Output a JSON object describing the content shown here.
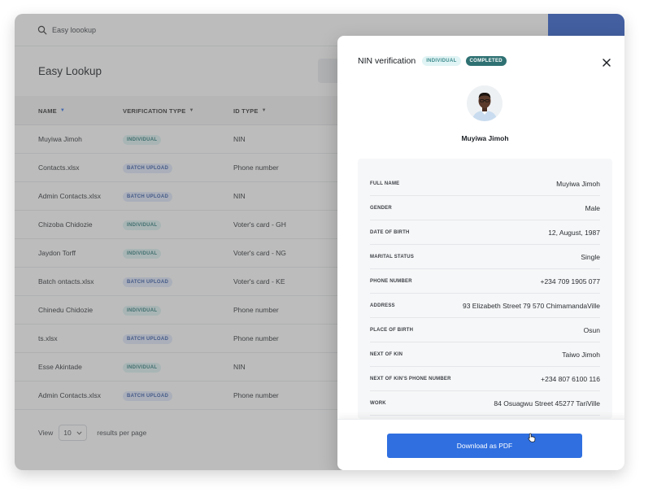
{
  "search": {
    "text": "Easy loookup"
  },
  "page": {
    "title": "Easy Lookup"
  },
  "table": {
    "headers": {
      "name": "NAME",
      "verification_type": "VERIFICATION TYPE",
      "id_type": "ID TYPE"
    },
    "rows": [
      {
        "name": "Muyiwa Jimoh",
        "type": "INDIVIDUAL",
        "id_type": "NIN"
      },
      {
        "name": "Contacts.xlsx",
        "type": "BATCH UPLOAD",
        "id_type": "Phone number"
      },
      {
        "name": "Admin Contacts.xlsx",
        "type": "BATCH UPLOAD",
        "id_type": "NIN"
      },
      {
        "name": "Chizoba Chidozie",
        "type": "INDIVIDUAL",
        "id_type": "Voter's card - GH"
      },
      {
        "name": "Jaydon Torff",
        "type": "INDIVIDUAL",
        "id_type": "Voter's card - NG"
      },
      {
        "name": "Batch ontacts.xlsx",
        "type": "BATCH UPLOAD",
        "id_type": "Voter's card - KE"
      },
      {
        "name": "Chinedu Chidozie",
        "type": "INDIVIDUAL",
        "id_type": "Phone number"
      },
      {
        "name": "ts.xlsx",
        "type": "BATCH UPLOAD",
        "id_type": "Phone number"
      },
      {
        "name": "Esse Akintade",
        "type": "INDIVIDUAL",
        "id_type": "NIN"
      },
      {
        "name": "Admin Contacts.xlsx",
        "type": "BATCH UPLOAD",
        "id_type": "Phone number"
      }
    ]
  },
  "pager": {
    "label_before": "View",
    "value": "10",
    "label_after": "results per page"
  },
  "modal": {
    "title": "NIN verification",
    "badge_type": "INDIVIDUAL",
    "badge_status": "COMPLETED",
    "person_name": "Muyiwa Jimoh",
    "details": [
      {
        "label": "FULL NAME",
        "value": "Muyiwa Jimoh"
      },
      {
        "label": "GENDER",
        "value": "Male"
      },
      {
        "label": "DATE OF BIRTH",
        "value": "12, August, 1987"
      },
      {
        "label": "MARITAL STATUS",
        "value": "Single"
      },
      {
        "label": "PHONE NUMBER",
        "value": "+234 709 1905 077"
      },
      {
        "label": "ADDRESS",
        "value": "93 Elizabeth Street 79 570 ChimamandaVille"
      },
      {
        "label": "PLACE OF BIRTH",
        "value": "Osun"
      },
      {
        "label": "NEXT OF KIN",
        "value": "Taiwo Jimoh"
      },
      {
        "label": "NEXT OF KIN'S PHONE NUMBER",
        "value": "+234 807 6100 116"
      },
      {
        "label": "WORK",
        "value": "84 Osuagwu Street 45277 TariVille"
      }
    ],
    "download_label": "Download as PDF"
  },
  "colors": {
    "accent": "#2f6fe0",
    "completed_badge": "#2f7173",
    "individual_badge_bg": "#dff3f3",
    "batch_badge_bg": "#e1e9fb"
  },
  "icons": {
    "search": "search-icon",
    "close": "close-icon",
    "sort": "caret-down-icon",
    "select": "chevron-down-icon",
    "cursor": "hand-pointer-icon"
  }
}
